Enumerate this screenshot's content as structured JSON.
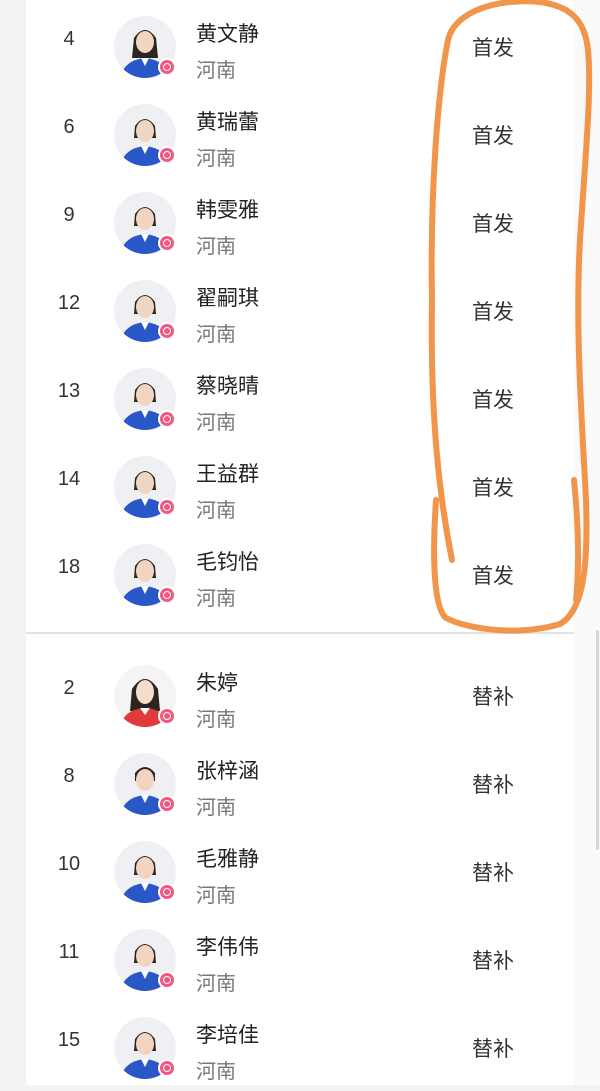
{
  "starters": [
    {
      "number": "4",
      "name": "黄文静",
      "team": "河南",
      "role": "首发"
    },
    {
      "number": "6",
      "name": "黄瑞蕾",
      "team": "河南",
      "role": "首发"
    },
    {
      "number": "9",
      "name": "韩雯雅",
      "team": "河南",
      "role": "首发"
    },
    {
      "number": "12",
      "name": "翟嗣琪",
      "team": "河南",
      "role": "首发"
    },
    {
      "number": "13",
      "name": "蔡晓晴",
      "team": "河南",
      "role": "首发"
    },
    {
      "number": "14",
      "name": "王益群",
      "team": "河南",
      "role": "首发"
    },
    {
      "number": "18",
      "name": "毛钧怡",
      "team": "河南",
      "role": "首发"
    }
  ],
  "substitutes": [
    {
      "number": "2",
      "name": "朱婷",
      "team": "河南",
      "role": "替补"
    },
    {
      "number": "8",
      "name": "张梓涵",
      "team": "河南",
      "role": "替补"
    },
    {
      "number": "10",
      "name": "毛雅静",
      "team": "河南",
      "role": "替补"
    },
    {
      "number": "11",
      "name": "李伟伟",
      "team": "河南",
      "role": "替补"
    },
    {
      "number": "15",
      "name": "李培佳",
      "team": "河南",
      "role": "替补"
    }
  ],
  "colors": {
    "jersey": "#2a57c8",
    "badge": "#f2587c",
    "annotation": "#f0954a"
  },
  "icons": {
    "player_avatar": "player-photo",
    "badge": "pink-circle-badge-icon"
  }
}
